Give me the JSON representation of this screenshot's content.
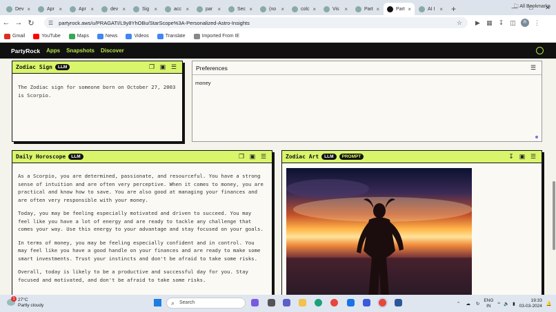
{
  "browser": {
    "tabs": [
      {
        "label": "Dev",
        "active": false
      },
      {
        "label": "Apr",
        "active": false
      },
      {
        "label": "Apr",
        "active": false
      },
      {
        "label": "dev",
        "active": false
      },
      {
        "label": "Sig",
        "active": false
      },
      {
        "label": "acc",
        "active": false
      },
      {
        "label": "par",
        "active": false
      },
      {
        "label": "Sec",
        "active": false
      },
      {
        "label": "(no",
        "active": false
      },
      {
        "label": "colc",
        "active": false
      },
      {
        "label": "Vis",
        "active": false
      },
      {
        "label": "Part",
        "active": false
      },
      {
        "label": "Part",
        "active": true
      },
      {
        "label": "AI I",
        "active": false
      }
    ],
    "url": "partyrock.aws/u/PRAGATI/L9y8YhOBu/StarScope%3A-Personalized-Astro-Insights",
    "profile_initial": "R",
    "bookmarks": [
      {
        "label": "Gmail",
        "color": "#d93025"
      },
      {
        "label": "YouTube",
        "color": "#ff0000"
      },
      {
        "label": "Maps",
        "color": "#34a853"
      },
      {
        "label": "News",
        "color": "#4285f4"
      },
      {
        "label": "Videos",
        "color": "#4285f4"
      },
      {
        "label": "Translate",
        "color": "#4285f4"
      },
      {
        "label": "Imported From IE",
        "color": "#888888"
      }
    ],
    "all_bookmarks": "All Bookmarks"
  },
  "partyrock": {
    "logo": "PartyRock",
    "nav": [
      "Apps",
      "Snapshots",
      "Discover"
    ],
    "accent": "#d9f56b"
  },
  "widgets": {
    "zodiac_sign": {
      "title": "Zodiac Sign",
      "badge": "LLM",
      "text": "The Zodiac sign for someone born on October 27, 2003 is Scorpio."
    },
    "preferences": {
      "title": "Preferences",
      "value": "money"
    },
    "horoscope": {
      "title": "Daily Horoscope",
      "badge": "LLM",
      "paragraphs": [
        "As a Scorpio, you are determined, passionate, and resourceful. You have a strong sense of intuition and are often very perceptive. When it comes to money, you are practical and know how to save. You are also good at managing your finances and are often very responsible with your money.",
        "Today, you may be feeling especially motivated and driven to succeed. You may feel like you have a lot of energy and are ready to tackle any challenge that comes your way. Use this energy to your advantage and stay focused on your goals.",
        "In terms of money, you may be feeling especially confident and in control. You may feel like you have a good handle on your finances and are ready to make some smart investments. Trust your instincts and don't be afraid to take some risks.",
        "Overall, today is likely to be a productive and successful day for you. Stay focused and motivated, and don't be afraid to take some risks."
      ]
    },
    "zodiac_art": {
      "title": "Zodiac Art",
      "badge_llm": "LLM",
      "badge_prompt": "PROMPT"
    }
  },
  "taskbar": {
    "weather_temp": "27°C",
    "weather_desc": "Partly cloudy",
    "notif_count": "1",
    "search": "Search",
    "lang1": "ENG",
    "lang2": "IN",
    "time": "19:33",
    "date": "03-03-2024"
  }
}
